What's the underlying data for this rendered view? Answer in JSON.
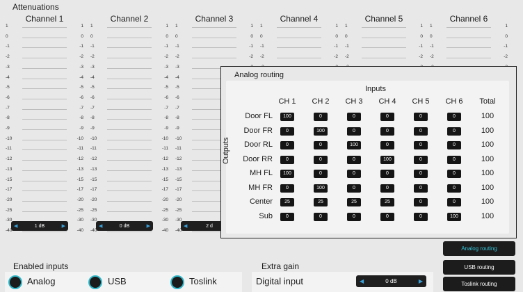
{
  "attenuations": {
    "title": "Attenuations",
    "ticks_left": [
      "1",
      "0",
      "-1",
      "-2",
      "-3",
      "-4",
      "-5",
      "-6",
      "-7",
      "-8",
      "-9",
      "-10",
      "-11",
      "-12",
      "-13",
      "-15",
      "-17",
      "-20",
      "-25",
      "-30",
      "-40"
    ],
    "ticks_right": [
      "1",
      "0",
      "-1",
      "-2",
      "-3",
      "-4",
      "-5",
      "-6",
      "-7",
      "-8",
      "-9",
      "-10",
      "-11",
      "-12",
      "-13",
      "-15",
      "-17",
      "-20",
      "-25",
      "-30",
      "-40"
    ],
    "channels": [
      {
        "name": "Channel 1",
        "value": "1 dB"
      },
      {
        "name": "Channel 2",
        "value": "0 dB"
      },
      {
        "name": "Channel 3",
        "value": "2 d"
      },
      {
        "name": "Channel 4",
        "value": ""
      },
      {
        "name": "Channel 5",
        "value": ""
      },
      {
        "name": "Channel 6",
        "value": ""
      }
    ],
    "arrow_left": "◀",
    "arrow_right": "▶"
  },
  "routing": {
    "title": "Analog routing",
    "inputs_label": "Inputs",
    "outputs_label": "Outputs",
    "columns": [
      "CH 1",
      "CH 2",
      "CH 3",
      "CH 4",
      "CH 5",
      "CH 6",
      "Total"
    ],
    "rows": [
      {
        "label": "Door FL",
        "values": [
          "100",
          "0",
          "0",
          "0",
          "0",
          "0"
        ],
        "total": "100"
      },
      {
        "label": "Door FR",
        "values": [
          "0",
          "100",
          "0",
          "0",
          "0",
          "0"
        ],
        "total": "100"
      },
      {
        "label": "Door RL",
        "values": [
          "0",
          "0",
          "100",
          "0",
          "0",
          "0"
        ],
        "total": "100"
      },
      {
        "label": "Door RR",
        "values": [
          "0",
          "0",
          "0",
          "100",
          "0",
          "0"
        ],
        "total": "100"
      },
      {
        "label": "MH FL",
        "values": [
          "100",
          "0",
          "0",
          "0",
          "0",
          "0"
        ],
        "total": "100"
      },
      {
        "label": "MH FR",
        "values": [
          "0",
          "100",
          "0",
          "0",
          "0",
          "0"
        ],
        "total": "100"
      },
      {
        "label": "Center",
        "values": [
          "25",
          "25",
          "25",
          "25",
          "0",
          "0"
        ],
        "total": "100"
      },
      {
        "label": "Sub",
        "values": [
          "0",
          "0",
          "0",
          "0",
          "0",
          "100"
        ],
        "total": "100"
      }
    ]
  },
  "enabled_inputs": {
    "title": "Enabled inputs",
    "options": [
      "Analog",
      "USB",
      "Toslink"
    ]
  },
  "extra_gain": {
    "title": "Extra gain",
    "label": "Digital input",
    "value": "0 dB"
  },
  "route_buttons": [
    "Analog routing",
    "USB routing",
    "Toslink routing"
  ],
  "colors": {
    "accent": "#31b7c8",
    "arrow": "#3aa0d8",
    "dark": "#1c1c1c"
  }
}
